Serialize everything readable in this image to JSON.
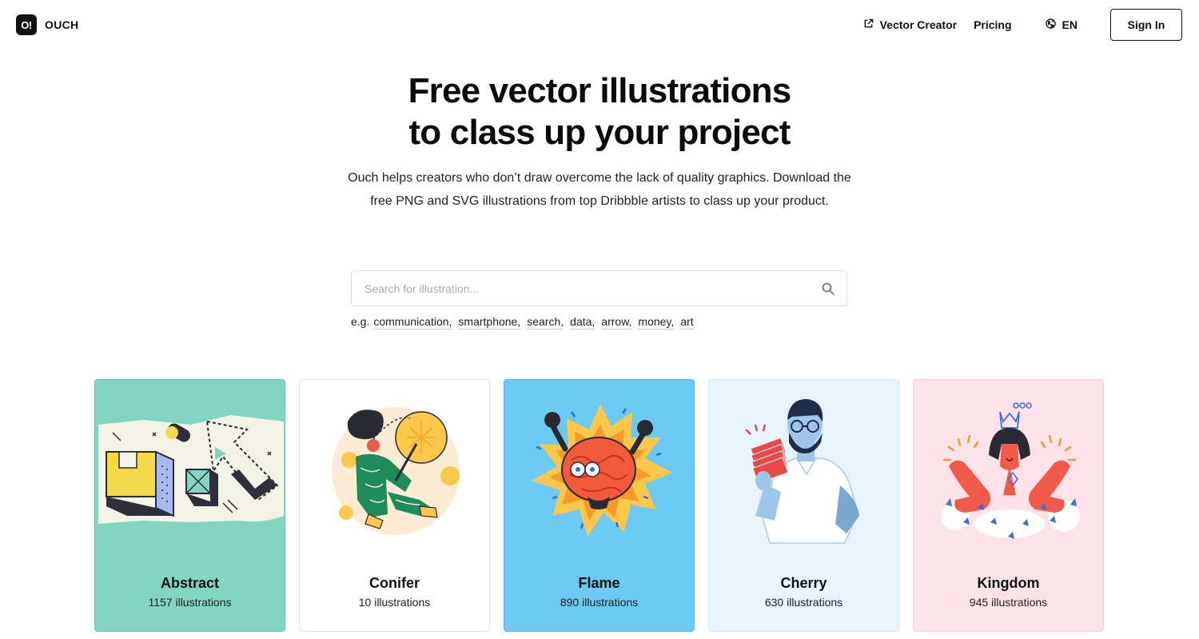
{
  "header": {
    "logo_mark": "O!",
    "logo_text": "OUCH",
    "nav": {
      "vector_creator": "Vector Creator",
      "pricing": "Pricing",
      "language": "EN",
      "sign_in": "Sign In"
    },
    "icons": {
      "vector_creator": "external-link-icon",
      "language": "globe-icon"
    }
  },
  "hero": {
    "title_line1": "Free vector illustrations",
    "title_line2": "to class up your project",
    "subtitle": "Ouch helps creators who don’t draw overcome the lack of quality graphics. Download the free PNG and SVG illustrations from top Dribbble artists to class up your product."
  },
  "search": {
    "placeholder": "Search for illustration...",
    "value": "",
    "icon": "search-icon",
    "examples_prefix": "e.g.",
    "examples": [
      "communication,",
      "smartphone,",
      "search,",
      "data,",
      "arrow,",
      "money,",
      "art"
    ]
  },
  "cards": [
    {
      "name": "Abstract",
      "count": "1157 illustrations",
      "bg": "#82d6c1"
    },
    {
      "name": "Conifer",
      "count": "10 illustrations",
      "bg": "#ffffff"
    },
    {
      "name": "Flame",
      "count": "890 illustrations",
      "bg": "#6ccaf2"
    },
    {
      "name": "Cherry",
      "count": "630 illustrations",
      "bg": "#e6f4fd"
    },
    {
      "name": "Kingdom",
      "count": "945 illustrations",
      "bg": "#fde3e9"
    }
  ]
}
